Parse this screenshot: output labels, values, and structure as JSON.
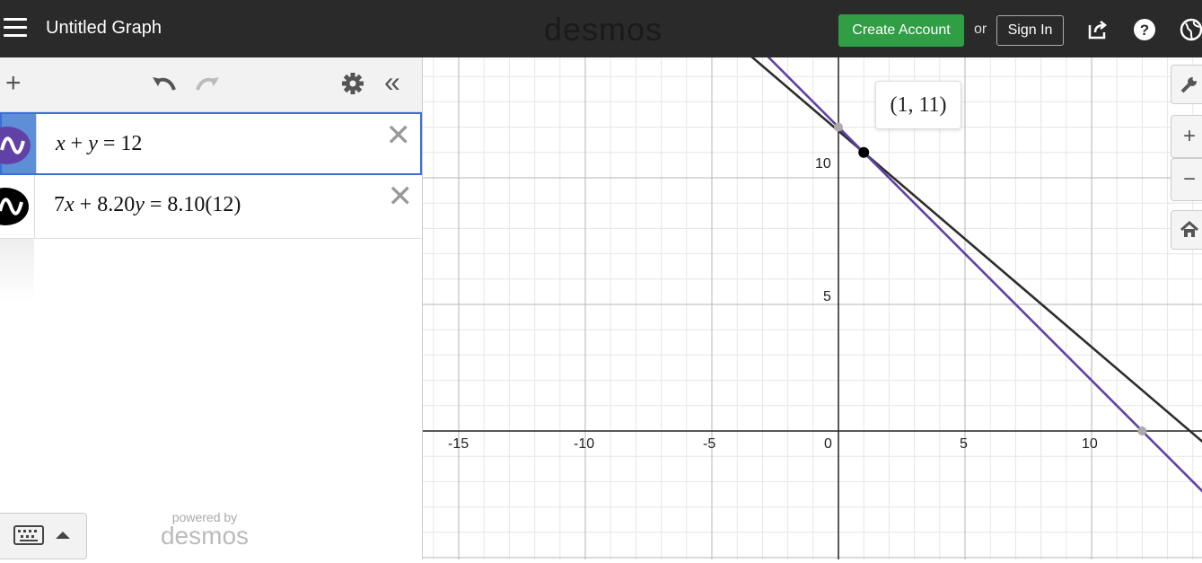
{
  "app": {
    "title": "Untitled Graph",
    "logo": "desmos",
    "create_account": "Create Account",
    "or": "or",
    "sign_in": "Sign In",
    "icons": [
      "menu-icon",
      "share-icon",
      "help-icon",
      "language-icon"
    ]
  },
  "expressions": [
    {
      "index": 1,
      "latex": "x + y = 12",
      "color": "#6042a6"
    },
    {
      "index": 2,
      "latex": "7x + 8.20y = 8.10(12)",
      "color": "#000000"
    }
  ],
  "footer": {
    "powered_by": "powered by",
    "brand": "desmos"
  },
  "graph": {
    "x_ticks": [
      "-15",
      "-10",
      "-5",
      "0",
      "5",
      "10"
    ],
    "y_ticks": [
      "10",
      "5"
    ],
    "point_label": "(1, 11)"
  },
  "chart_data": {
    "type": "line",
    "series": [
      {
        "name": "x + y = 12",
        "color": "#6042a6",
        "equation": "y = 12 - x"
      },
      {
        "name": "7x + 8.20y = 8.10(12)",
        "color": "#2d2d2d",
        "equation": "y = (97.2 - 7x)/8.2"
      }
    ],
    "points": [
      {
        "label": "(1, 11)",
        "x": 1,
        "y": 11
      },
      {
        "label": "",
        "x": 0,
        "y": 12
      },
      {
        "label": "",
        "x": 12,
        "y": 0
      }
    ],
    "xlim": [
      -16.2,
      14.5
    ],
    "ylim": [
      -5,
      14.8
    ],
    "grid": true
  }
}
